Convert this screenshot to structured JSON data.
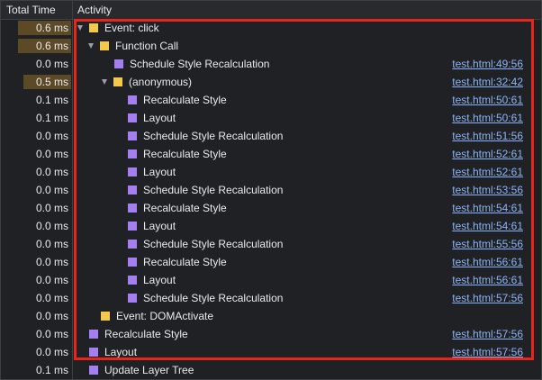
{
  "header": {
    "total_time": "Total Time",
    "activity": "Activity"
  },
  "rows": [
    {
      "time": "0.6 ms",
      "bar": 0.8,
      "tri": true,
      "icon": "yellow",
      "label": "Event: click",
      "link": "",
      "indent": 0
    },
    {
      "time": "0.6 ms",
      "bar": 0.8,
      "tri": true,
      "icon": "yellow",
      "label": "Function Call",
      "link": "",
      "indent": 1
    },
    {
      "time": "0.0 ms",
      "bar": 0,
      "tri": false,
      "icon": "purple",
      "label": "Schedule Style Recalculation",
      "link": "test.html:49:56",
      "indent": 2
    },
    {
      "time": "0.5 ms",
      "bar": 0.72,
      "tri": true,
      "icon": "yellow",
      "label": "(anonymous)",
      "link": "test.html:32:42",
      "indent": 2
    },
    {
      "time": "0.1 ms",
      "bar": 0,
      "tri": false,
      "icon": "purple",
      "label": "Recalculate Style",
      "link": "test.html:50:61",
      "indent": 3
    },
    {
      "time": "0.1 ms",
      "bar": 0,
      "tri": false,
      "icon": "purple",
      "label": "Layout",
      "link": "test.html:50:61",
      "indent": 3
    },
    {
      "time": "0.0 ms",
      "bar": 0,
      "tri": false,
      "icon": "purple",
      "label": "Schedule Style Recalculation",
      "link": "test.html:51:56",
      "indent": 3
    },
    {
      "time": "0.0 ms",
      "bar": 0,
      "tri": false,
      "icon": "purple",
      "label": "Recalculate Style",
      "link": "test.html:52:61",
      "indent": 3
    },
    {
      "time": "0.0 ms",
      "bar": 0,
      "tri": false,
      "icon": "purple",
      "label": "Layout",
      "link": "test.html:52:61",
      "indent": 3
    },
    {
      "time": "0.0 ms",
      "bar": 0,
      "tri": false,
      "icon": "purple",
      "label": "Schedule Style Recalculation",
      "link": "test.html:53:56",
      "indent": 3
    },
    {
      "time": "0.0 ms",
      "bar": 0,
      "tri": false,
      "icon": "purple",
      "label": "Recalculate Style",
      "link": "test.html:54:61",
      "indent": 3
    },
    {
      "time": "0.0 ms",
      "bar": 0,
      "tri": false,
      "icon": "purple",
      "label": "Layout",
      "link": "test.html:54:61",
      "indent": 3
    },
    {
      "time": "0.0 ms",
      "bar": 0,
      "tri": false,
      "icon": "purple",
      "label": "Schedule Style Recalculation",
      "link": "test.html:55:56",
      "indent": 3
    },
    {
      "time": "0.0 ms",
      "bar": 0,
      "tri": false,
      "icon": "purple",
      "label": "Recalculate Style",
      "link": "test.html:56:61",
      "indent": 3
    },
    {
      "time": "0.0 ms",
      "bar": 0,
      "tri": false,
      "icon": "purple",
      "label": "Layout",
      "link": "test.html:56:61",
      "indent": 3
    },
    {
      "time": "0.0 ms",
      "bar": 0,
      "tri": false,
      "icon": "purple",
      "label": "Schedule Style Recalculation",
      "link": "test.html:57:56",
      "indent": 3
    },
    {
      "time": "0.0 ms",
      "bar": 0,
      "tri": false,
      "icon": "yellow",
      "label": "Event: DOMActivate",
      "link": "",
      "indent": 1
    },
    {
      "time": "0.0 ms",
      "bar": 0,
      "tri": false,
      "icon": "purple",
      "label": "Recalculate Style",
      "link": "test.html:57:56",
      "indent": 0
    },
    {
      "time": "0.0 ms",
      "bar": 0,
      "tri": false,
      "icon": "purple",
      "label": "Layout",
      "link": "test.html:57:56",
      "indent": 0
    },
    {
      "time": "0.1 ms",
      "bar": 0,
      "tri": false,
      "icon": "purple",
      "label": "Update Layer Tree",
      "link": "",
      "indent": 0
    }
  ],
  "colors": {
    "bar": "#5c4a26",
    "yellow": "#f2c94c",
    "purple": "#a57ff0",
    "highlight": "#e8251a",
    "link": "#8ab4f8"
  }
}
